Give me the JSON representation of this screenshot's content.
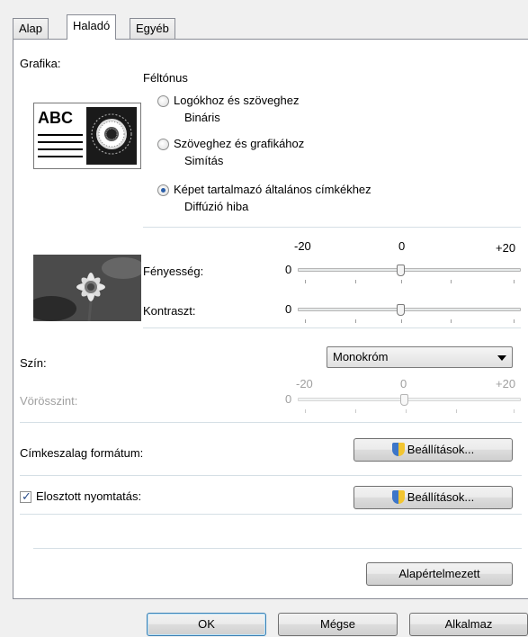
{
  "tabs": [
    "Alap",
    "Haladó",
    "Egyéb"
  ],
  "active_tab": 1,
  "graphics": {
    "label": "Grafika:",
    "halftone_heading": "Féltónus",
    "options": [
      {
        "title": "Logókhoz és szöveghez",
        "sub": "Bináris",
        "selected": false
      },
      {
        "title": "Szöveghez és grafikához",
        "sub": "Simítás",
        "selected": false
      },
      {
        "title": "Képet tartalmazó általános címkékhez",
        "sub": "Diffúzió hiba",
        "selected": true
      }
    ],
    "preview_text": "ABC"
  },
  "adjust": {
    "scale_min": "-20",
    "scale_mid": "0",
    "scale_max": "+20",
    "brightness_label": "Fényesség:",
    "brightness_value": "0",
    "contrast_label": "Kontraszt:",
    "contrast_value": "0"
  },
  "color": {
    "label": "Szín:",
    "selected": "Monokróm",
    "red_label": "Vörösszint:",
    "red_scale_min": "-20",
    "red_scale_mid": "0",
    "red_scale_max": "+20",
    "red_value": "0"
  },
  "tape_format": {
    "label": "Címkeszalag formátum:",
    "button": "Beállítások..."
  },
  "distributed": {
    "label": "Elosztott nyomtatás:",
    "checked": true,
    "button": "Beállítások..."
  },
  "defaults_button": "Alapértelmezett",
  "footer": {
    "ok": "OK",
    "cancel": "Mégse",
    "apply": "Alkalmaz"
  }
}
